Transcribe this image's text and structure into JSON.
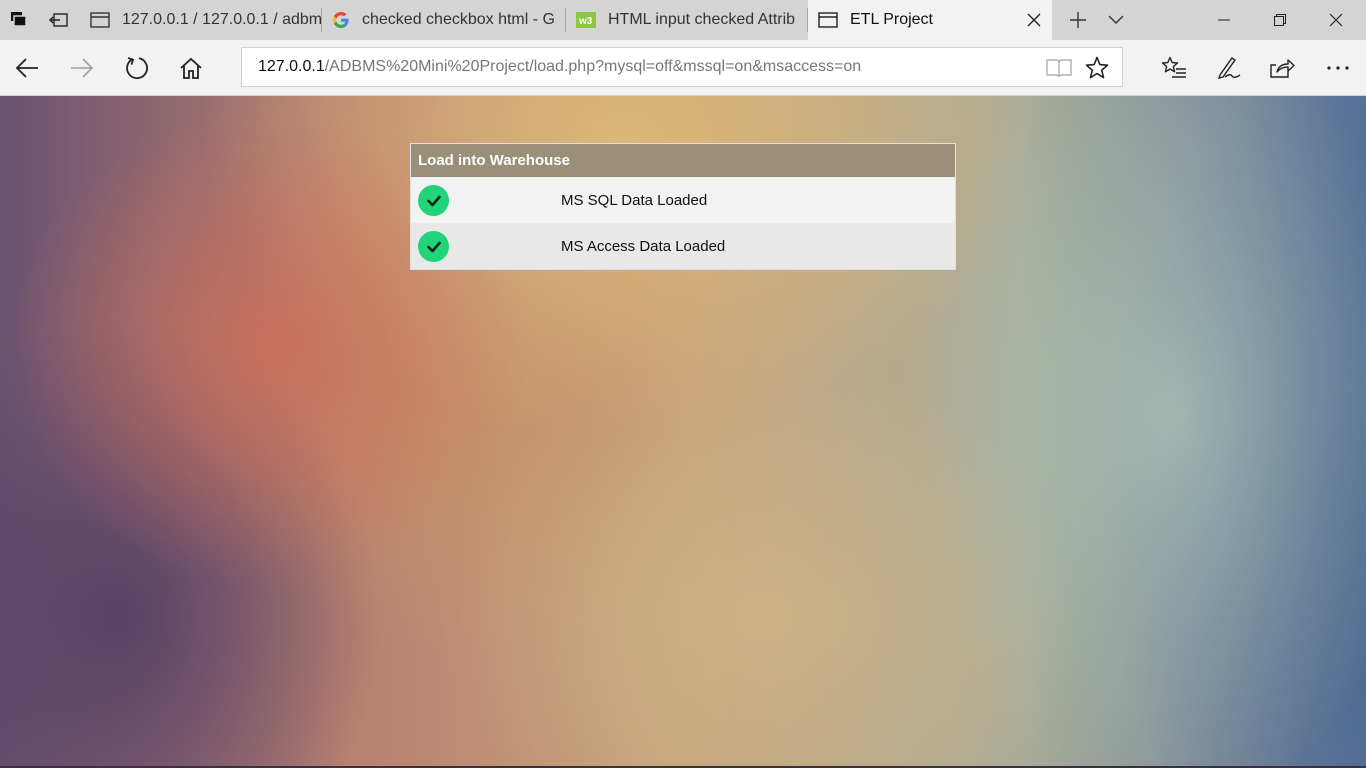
{
  "browser": {
    "tabs": [
      {
        "title": "127.0.0.1 / 127.0.0.1 / adbm",
        "icon": "page-icon"
      },
      {
        "title": "checked checkbox html - G",
        "icon": "google-icon"
      },
      {
        "title": "HTML input checked Attrib",
        "icon": "w3schools-icon"
      },
      {
        "title": "ETL Project",
        "icon": "page-icon",
        "active": true
      }
    ],
    "address": {
      "host": "127.0.0.1",
      "path": "/ADBMS%20Mini%20Project/load.php?mysql=off&mssql=on&msaccess=on"
    }
  },
  "panel": {
    "header": "Load into Warehouse",
    "rows": [
      {
        "label": "MS SQL Data Loaded",
        "status": "check-icon"
      },
      {
        "label": "MS Access Data Loaded",
        "status": "check-icon"
      }
    ]
  },
  "colors": {
    "panel_header": "#9a907a",
    "check_green": "#21d47a"
  }
}
